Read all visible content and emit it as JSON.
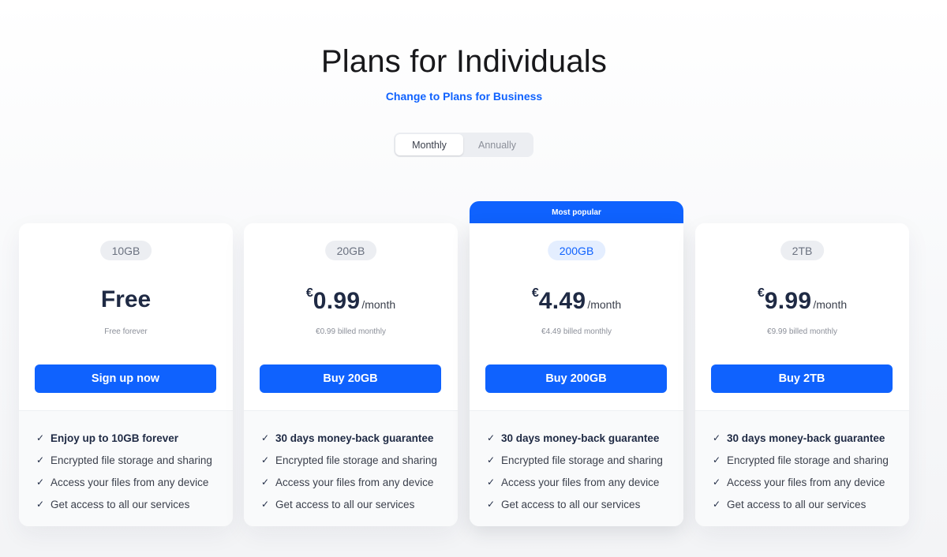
{
  "header": {
    "title": "Plans for Individuals",
    "business_link": "Change to Plans for Business"
  },
  "billing_toggle": {
    "options": [
      "Monthly",
      "Annually"
    ],
    "selected": "Monthly"
  },
  "popular_badge": "Most popular",
  "colors": {
    "accent": "#0f62fe",
    "price_text": "#1f2a44"
  },
  "plans": [
    {
      "storage": "10GB",
      "price": "Free",
      "billing_note": "Free forever",
      "button_label": "Sign up now",
      "features": [
        "Enjoy up to 10GB forever",
        "Encrypted file storage and sharing",
        "Access your files from any device",
        "Get access to all our services"
      ]
    },
    {
      "storage": "20GB",
      "currency": "€",
      "price": "0.99",
      "period": "/month",
      "billing_note": "€0.99 billed monthly",
      "button_label": "Buy 20GB",
      "features": [
        "30 days money-back guarantee",
        "Encrypted file storage and sharing",
        "Access your files from any device",
        "Get access to all our services"
      ]
    },
    {
      "storage": "200GB",
      "currency": "€",
      "price": "4.49",
      "period": "/month",
      "billing_note": "€4.49 billed monthly",
      "button_label": "Buy 200GB",
      "features": [
        "30 days money-back guarantee",
        "Encrypted file storage and sharing",
        "Access your files from any device",
        "Get access to all our services"
      ]
    },
    {
      "storage": "2TB",
      "currency": "€",
      "price": "9.99",
      "period": "/month",
      "billing_note": "€9.99 billed monthly",
      "button_label": "Buy 2TB",
      "features": [
        "30 days money-back guarantee",
        "Encrypted file storage and sharing",
        "Access your files from any device",
        "Get access to all our services"
      ]
    }
  ],
  "feature_check_glyph": "✓"
}
